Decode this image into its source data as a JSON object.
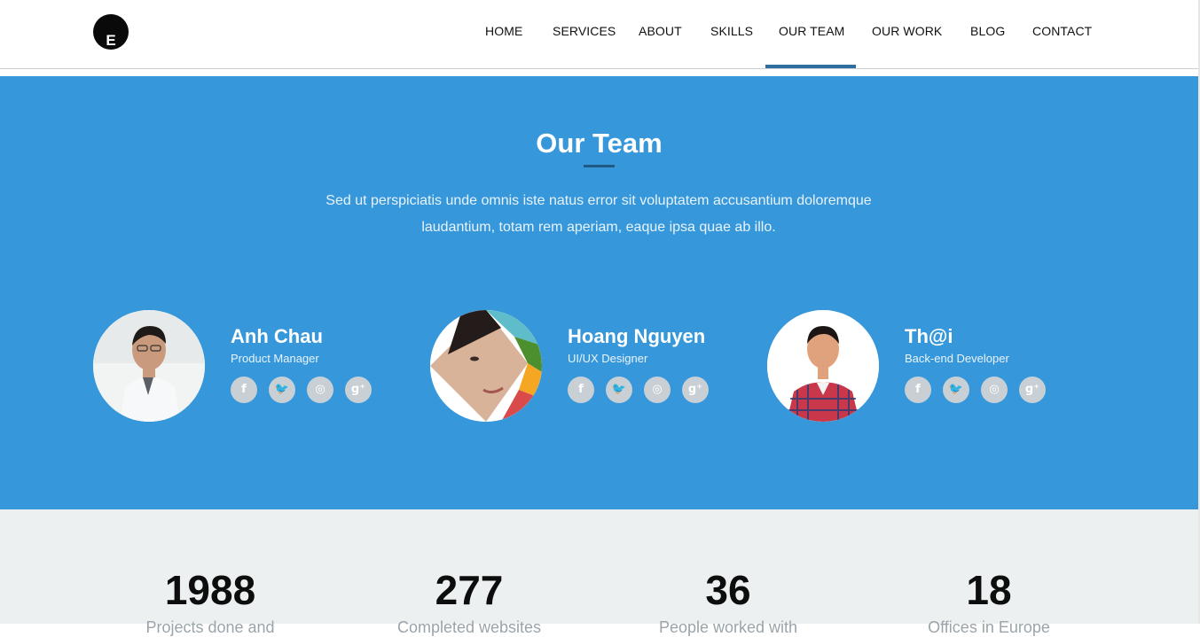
{
  "logo": {
    "letter": "E"
  },
  "nav": {
    "items": [
      {
        "label": "HOME"
      },
      {
        "label": "SERVICES"
      },
      {
        "label": "ABOUT"
      },
      {
        "label": "SKILLS"
      },
      {
        "label": "OUR TEAM",
        "active": true
      },
      {
        "label": "OUR WORK"
      },
      {
        "label": "BLOG"
      },
      {
        "label": "CONTACT"
      }
    ]
  },
  "team": {
    "title": "Our Team",
    "description": "Sed ut perspiciatis unde omnis iste natus error sit voluptatem accusantium doloremque laudantium, totam rem aperiam, eaque ipsa quae ab illo.",
    "members": [
      {
        "name": "Anh Chau",
        "role": "Product Manager"
      },
      {
        "name": "Hoang Nguyen",
        "role": "UI/UX Designer"
      },
      {
        "name": "Th@i",
        "role": "Back-end Developer"
      }
    ],
    "social_icons": {
      "facebook": "f",
      "twitter": "🐦",
      "dribbble": "◎",
      "google_plus": "g⁺"
    }
  },
  "stats": [
    {
      "number": "1988",
      "label": "Projects done and"
    },
    {
      "number": "277",
      "label": "Completed websites"
    },
    {
      "number": "36",
      "label": "People worked with"
    },
    {
      "number": "18",
      "label": "Offices in Europe"
    }
  ],
  "colors": {
    "team_background": "#3697db",
    "stats_background": "#ecf0f1",
    "nav_active_indicator": "#2f6f9f",
    "social_icon_background": "#c9d0d5"
  }
}
